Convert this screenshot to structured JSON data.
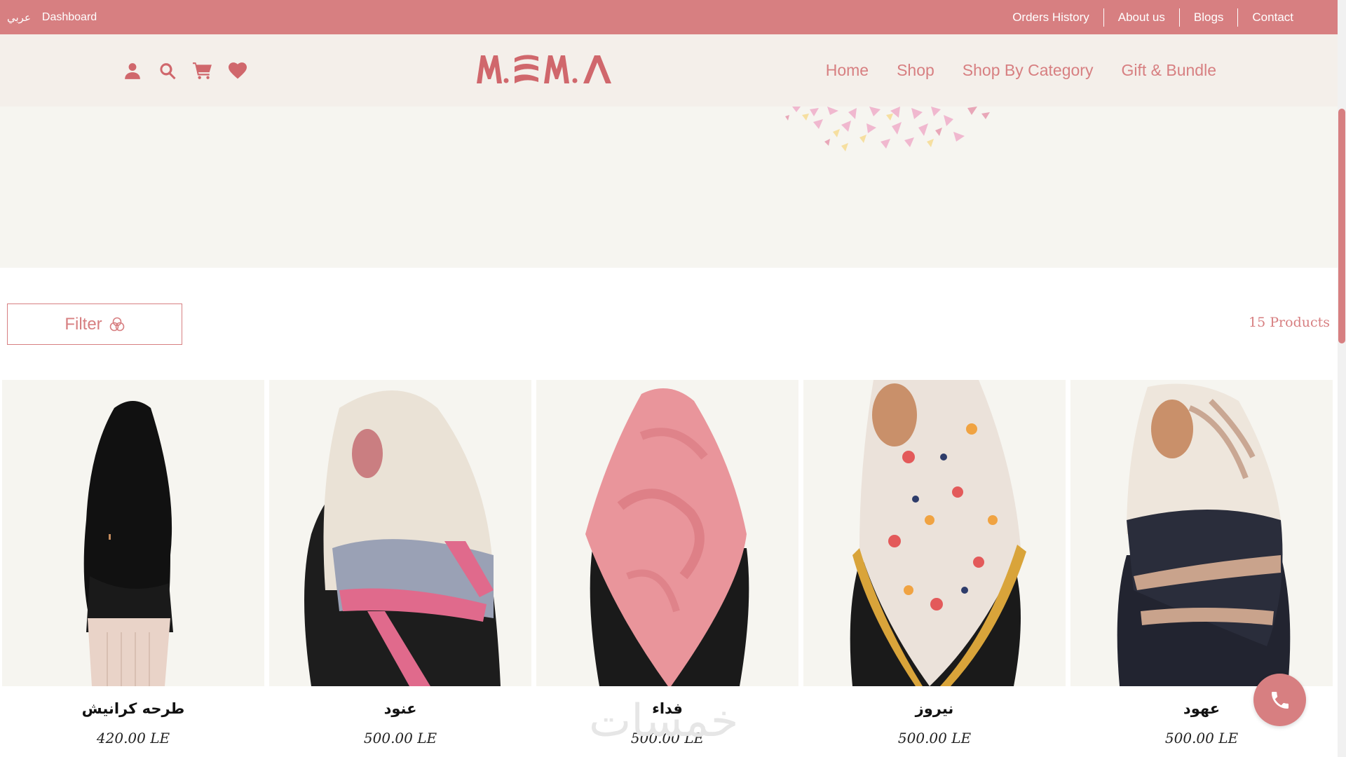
{
  "topbar": {
    "language": "عربي",
    "dashboard": "Dashboard",
    "links": [
      "Orders History",
      "About us",
      "Blogs",
      "Contact"
    ]
  },
  "header": {
    "logo_text": "MSEMA",
    "icons": [
      "user-icon",
      "search-icon",
      "cart-icon",
      "heart-icon"
    ],
    "nav": [
      "Home",
      "Shop",
      "Shop By Category",
      "Gift & Bundle"
    ]
  },
  "listing": {
    "filter_label": "Filter",
    "count_label": "15 Products"
  },
  "products": [
    {
      "name": "طرحه كرانيش",
      "price": "420.00 LE"
    },
    {
      "name": "عنود",
      "price": "500.00 LE"
    },
    {
      "name": "فداء",
      "price": "500.00 LE"
    },
    {
      "name": "نيروز",
      "price": "500.00 LE"
    },
    {
      "name": "عهود",
      "price": "500.00 LE"
    }
  ],
  "watermark": "خمسات",
  "colors": {
    "brand": "#d77f81",
    "header_bg": "#f4efea",
    "hero_bg": "#f6f5f0"
  }
}
